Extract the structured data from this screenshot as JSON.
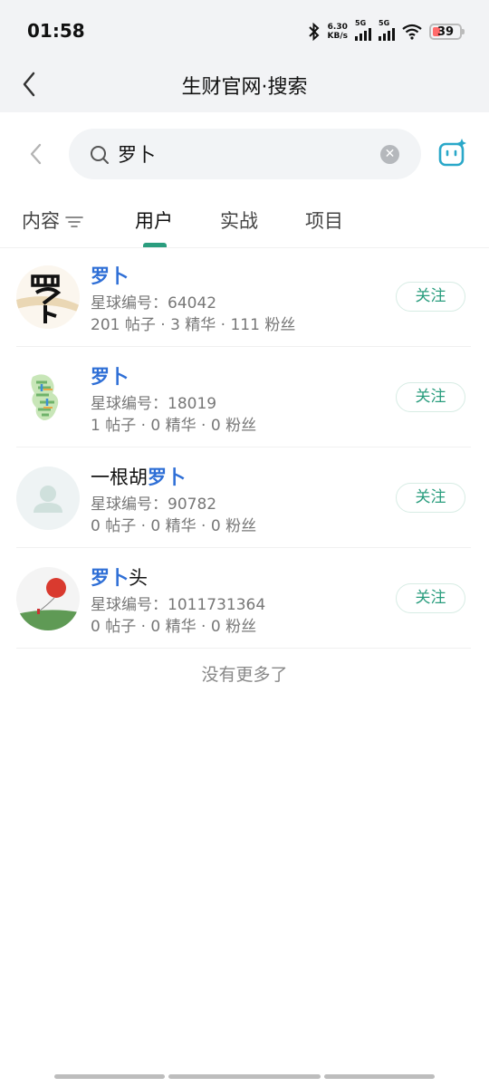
{
  "status": {
    "time": "01:58",
    "speed_value": "6.30",
    "speed_unit": "KB/s",
    "sig1": "5G",
    "sig2": "5G",
    "battery": "39"
  },
  "titlebar": {
    "title": "生财官网·搜索"
  },
  "search": {
    "query": "罗卜"
  },
  "tabs": [
    {
      "label": "内容"
    },
    {
      "label": "用户"
    },
    {
      "label": "实战"
    },
    {
      "label": "项目"
    }
  ],
  "results": [
    {
      "name_pre": "",
      "name_hl": "罗卜",
      "name_post": "",
      "id": "星球编号：64042",
      "stats": "201 帖子 · 3 精华 · 111 粉丝",
      "follow": "关注"
    },
    {
      "name_pre": "",
      "name_hl": "罗卜",
      "name_post": "",
      "id": "星球编号：18019",
      "stats": "1 帖子 · 0 精华 · 0 粉丝",
      "follow": "关注"
    },
    {
      "name_pre": "一根胡",
      "name_hl": "罗卜",
      "name_post": "",
      "id": "星球编号：90782",
      "stats": "0 帖子 · 0 精华 · 0 粉丝",
      "follow": "关注"
    },
    {
      "name_pre": "",
      "name_hl": "罗卜",
      "name_post": "头",
      "id": "星球编号：1011731364",
      "stats": "0 帖子 · 0 精华 · 0 粉丝",
      "follow": "关注"
    }
  ],
  "end_text": "没有更多了",
  "colors": {
    "accent": "#2a9d7e",
    "highlight": "#2f6fd6"
  }
}
